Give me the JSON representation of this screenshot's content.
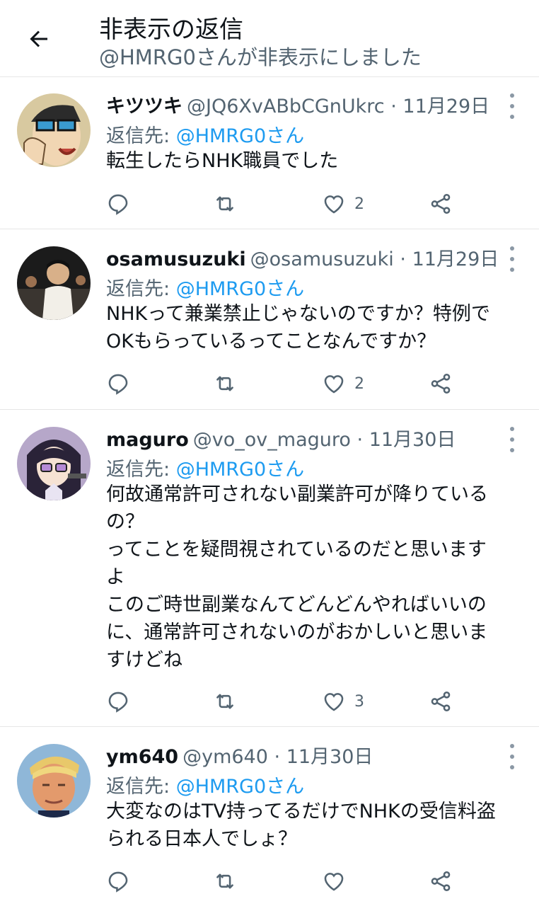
{
  "header": {
    "title": "非表示の返信",
    "subtitle": "@HMRG0さんが非表示にしました"
  },
  "tweets": [
    {
      "name": "キツツキ",
      "handle": "@JQ6XvABbCGnUkrc",
      "date": "11月29日",
      "reply_label": "返信先:",
      "reply_to": "@HMRG0さん",
      "text": "転生したらNHK職員でした",
      "likes": "2"
    },
    {
      "name": "osamusuzuki",
      "handle": "@osamusuzuki",
      "date": "11月29日",
      "reply_label": "返信先:",
      "reply_to": "@HMRG0さん",
      "text": "NHKって兼業禁止じゃないのですか？特例で\nOKもらっているってことなんですか？",
      "likes": "2"
    },
    {
      "name": "maguro",
      "handle": "@vo_ov_maguro",
      "date": "11月30日",
      "reply_label": "返信先:",
      "reply_to": "@HMRG0さん",
      "text": "何故通常許可されない副業許可が降りている\nの？\nってことを疑問視されているのだと思います\nよ\nこのご時世副業なんてどんどんやればいいの\nに、通常許可されないのがおかしいと思いま\nすけどね",
      "likes": "3"
    },
    {
      "name": "ym640",
      "handle": "@ym640",
      "date": "11月30日",
      "reply_label": "返信先:",
      "reply_to": "@HMRG0さん",
      "text": "大変なのはTV持ってるだけでNHKの受信料盗\nられる日本人でしょ？",
      "likes": ""
    }
  ],
  "separator": "·",
  "icons": {
    "back": "arrow-left-icon",
    "reply": "reply-icon",
    "retweet": "retweet-icon",
    "like": "heart-icon",
    "share": "share-icon",
    "more": "more-vertical-icon"
  },
  "colors": {
    "link": "#1d9bf0",
    "secondary": "#536471",
    "text": "#0f1419"
  }
}
